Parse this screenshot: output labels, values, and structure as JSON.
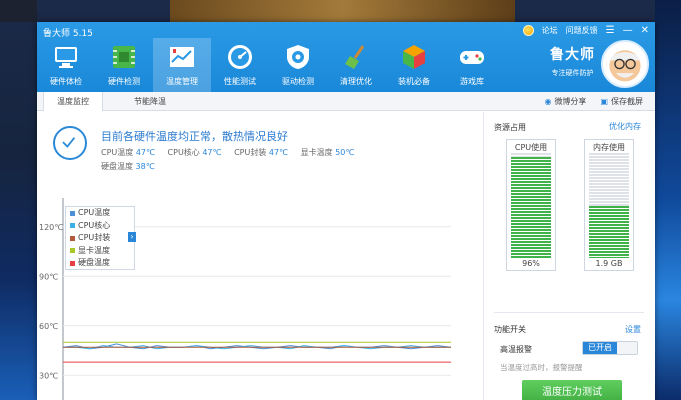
{
  "app": {
    "title": "鲁大师 5.15",
    "top_links": [
      "论坛",
      "问题反馈"
    ],
    "window_controls": [
      "menu-icon",
      "minimize-icon",
      "close-icon"
    ]
  },
  "nav": {
    "items": [
      {
        "label": "硬件体检",
        "icon": "hardware-check-icon"
      },
      {
        "label": "硬件检测",
        "icon": "circuit-board-icon"
      },
      {
        "label": "温度管理",
        "icon": "thermometer-chart-icon",
        "active": true
      },
      {
        "label": "性能测试",
        "icon": "speedometer-icon"
      },
      {
        "label": "驱动检测",
        "icon": "gear-shield-icon"
      },
      {
        "label": "清理优化",
        "icon": "broom-icon"
      },
      {
        "label": "装机必备",
        "icon": "cube-icon"
      },
      {
        "label": "游戏库",
        "icon": "gamepad-icon"
      }
    ]
  },
  "brand": {
    "name": "鲁大师",
    "slogan": "专注硬件防护"
  },
  "subnav": {
    "tabs": [
      {
        "label": "温度监控",
        "active": true
      },
      {
        "label": "节能降温"
      }
    ],
    "actions": [
      {
        "label": "微博分享",
        "icon": "weibo-icon"
      },
      {
        "label": "保存截屏",
        "icon": "camera-icon"
      }
    ]
  },
  "status": {
    "title": "目前各硬件温度均正常，散热情况良好",
    "readings": [
      {
        "label": "CPU温度",
        "value": "47℃"
      },
      {
        "label": "CPU核心",
        "value": "47℃"
      },
      {
        "label": "CPU封装",
        "value": "47℃"
      },
      {
        "label": "显卡温度",
        "value": "50℃"
      },
      {
        "label": "硬盘温度",
        "value": "38℃"
      }
    ]
  },
  "chart_data": {
    "type": "line",
    "y_ticks": [
      "120℃",
      "90℃",
      "60℃",
      "30℃"
    ],
    "ylim": [
      15,
      135
    ],
    "legend_placement": "top-left",
    "series": [
      {
        "name": "CPU温度",
        "color": "#4a8fd8",
        "values": [
          47,
          48,
          46,
          47,
          49,
          47,
          46,
          48,
          47,
          47,
          48,
          46,
          47,
          48,
          47,
          46,
          47,
          48,
          47,
          47,
          46,
          48,
          47,
          47,
          48,
          47,
          46,
          47,
          48,
          47
        ]
      },
      {
        "name": "CPU核心",
        "color": "#3ab0e8",
        "values": [
          47,
          47,
          46,
          48,
          47,
          47,
          48,
          46,
          47,
          47,
          48,
          47,
          46,
          47,
          48,
          47,
          47,
          46,
          48,
          47,
          47,
          48,
          47,
          46,
          47,
          47,
          48,
          47,
          47,
          47
        ]
      },
      {
        "name": "CPU封装",
        "color": "#b05a3a",
        "values": [
          47,
          47,
          47,
          47,
          47,
          47,
          47,
          47,
          47,
          47,
          47,
          47,
          47,
          47,
          47,
          47,
          47,
          47,
          47,
          47,
          47,
          47,
          47,
          47,
          47,
          47,
          47,
          47,
          47,
          47
        ]
      },
      {
        "name": "显卡温度",
        "color": "#a8c82a",
        "values": [
          50,
          50,
          50,
          50,
          50,
          50,
          50,
          50,
          50,
          50,
          50,
          50,
          50,
          50,
          50,
          50,
          50,
          50,
          50,
          50,
          50,
          50,
          50,
          50,
          50,
          50,
          50,
          50,
          50,
          50
        ]
      },
      {
        "name": "硬盘温度",
        "color": "#e84040",
        "values": [
          38,
          38,
          38,
          38,
          38,
          38,
          38,
          38,
          38,
          38,
          38,
          38,
          38,
          38,
          38,
          38,
          38,
          38,
          38,
          38,
          38,
          38,
          38,
          38,
          38,
          38,
          38,
          38,
          38,
          38
        ]
      }
    ]
  },
  "resources": {
    "title": "资源占用",
    "optimize_link": "优化内存",
    "cpu": {
      "label": "CPU使用",
      "value": "96%",
      "fraction": 0.96
    },
    "memory": {
      "label": "内存使用",
      "value": "1.9 GB",
      "fraction": 0.5
    }
  },
  "features": {
    "title": "功能开关",
    "settings_link": "设置",
    "alarm_label": "高温报警",
    "alarm_state": "已开启",
    "alarm_hint": "当温度过高时，报警提醒",
    "test_button": "温度压力测试"
  },
  "colors": {
    "accent": "#1a88d8",
    "green": "#3fb34a"
  }
}
